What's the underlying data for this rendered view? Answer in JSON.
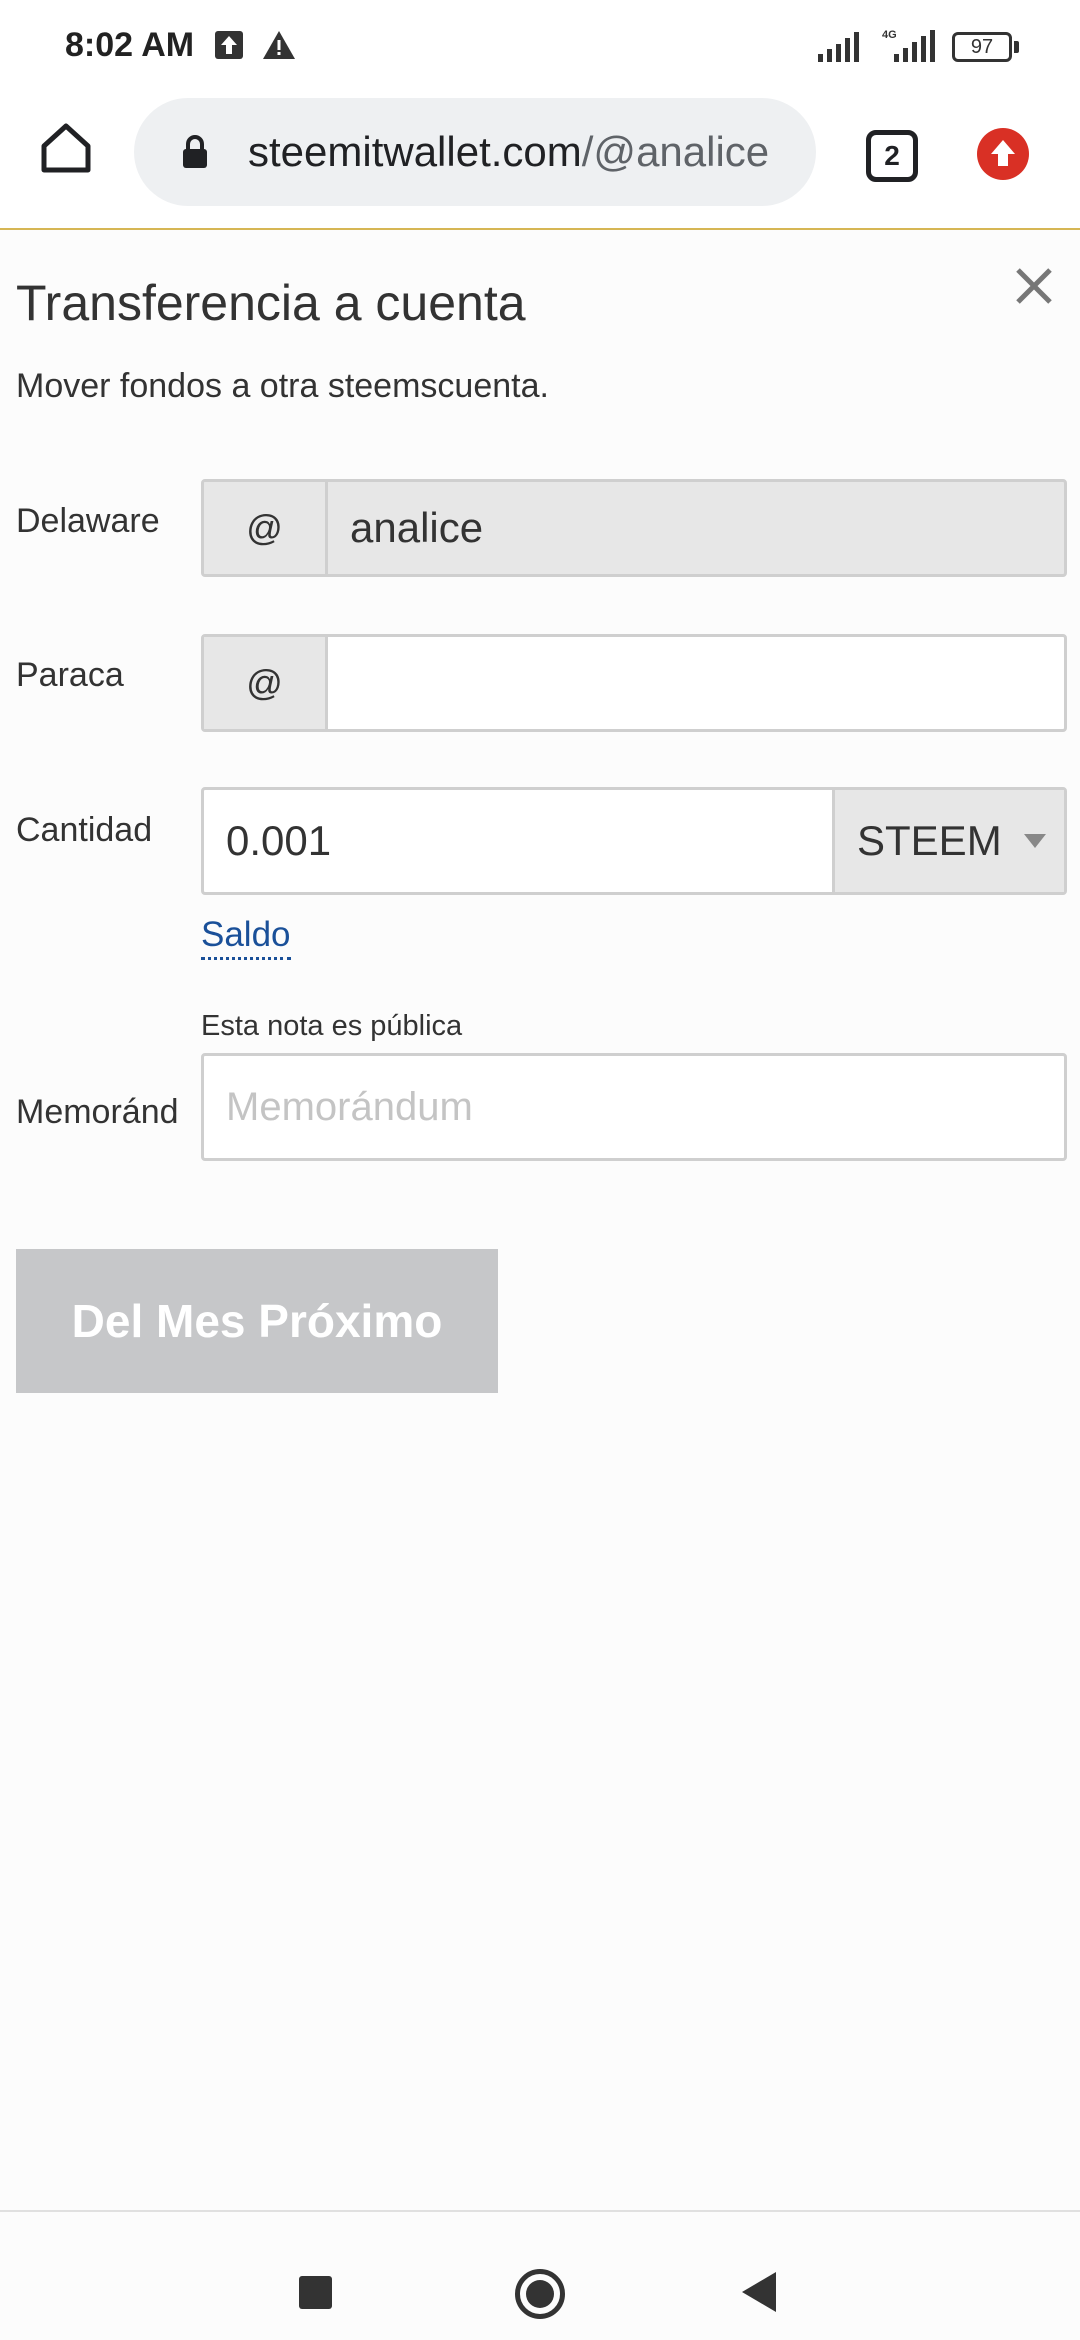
{
  "status_bar": {
    "time": "8:02 AM",
    "battery": "97",
    "network": "4G",
    "icons": [
      "upload-notification-icon",
      "warning-icon",
      "signal-icon",
      "signal-4g-icon",
      "battery-icon"
    ]
  },
  "browser": {
    "url_domain": "steemitwallet.com",
    "url_path": "/@analice",
    "tab_count": "2",
    "icons": [
      "home-icon",
      "lock-icon",
      "tabs-icon",
      "update-icon"
    ]
  },
  "dialog": {
    "title": "Transferencia a cuenta",
    "subtitle": "Mover fondos a otra steemscuenta.",
    "close_icon": "close-icon",
    "from": {
      "label": "Delaware",
      "prefix": "@",
      "value": "analice"
    },
    "to": {
      "label": "Paraca",
      "prefix": "@",
      "value": ""
    },
    "amount": {
      "label": "Cantidad",
      "value": "0.001",
      "asset": "STEEM"
    },
    "balance_link": "Saldo",
    "memo": {
      "note": "Esta nota es pública",
      "label": "Memoránd",
      "placeholder": "Memorándum",
      "value": ""
    },
    "submit_label": "Del Mes Próximo"
  },
  "colors": {
    "link": "#1a5099",
    "button_disabled": "#c6c7c9",
    "update_badge": "#d93025",
    "toolbar_border": "#d6b654"
  }
}
